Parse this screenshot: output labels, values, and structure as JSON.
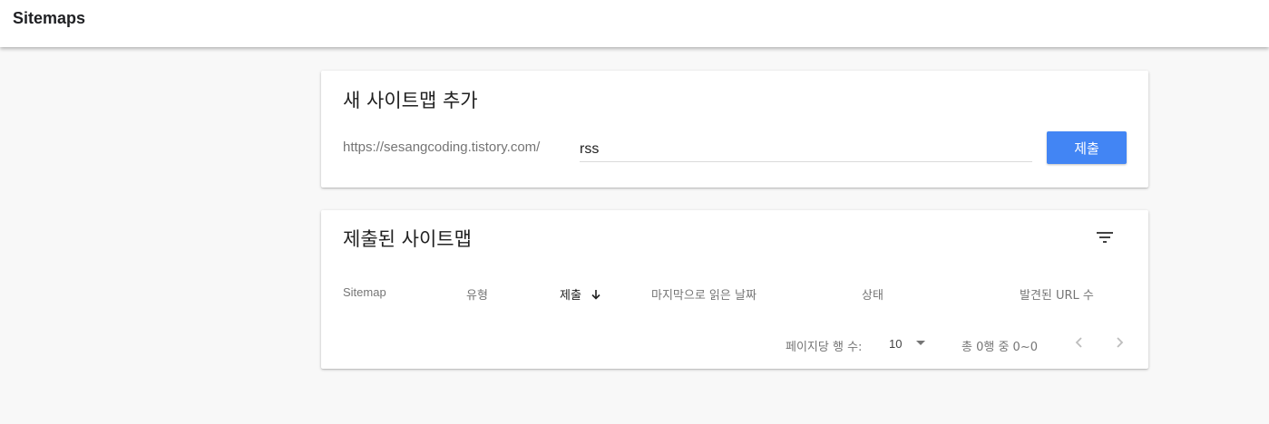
{
  "header": {
    "title": "Sitemaps"
  },
  "add_sitemap": {
    "title": "새 사이트맵 추가",
    "url_prefix": "https://sesangcoding.tistory.com/",
    "input_value": "rss",
    "submit_label": "제출"
  },
  "submitted_sitemaps": {
    "title": "제출된 사이트맵",
    "filter_icon": "filter-list-icon",
    "columns": {
      "sitemap": "Sitemap",
      "type": "유형",
      "submitted": "제출",
      "last_read": "마지막으로 읽은 날짜",
      "status": "상태",
      "discovered_urls": "발견된 URL 수"
    },
    "sort_icon": "arrow-downward-icon",
    "pagination": {
      "rows_per_page_label": "페이지당 행 수:",
      "rows_per_page_value": "10",
      "range_text": "총 0행 중 0~0"
    }
  },
  "colors": {
    "accent": "#4285f4",
    "background": "#f8f8f8",
    "card": "#ffffff"
  }
}
